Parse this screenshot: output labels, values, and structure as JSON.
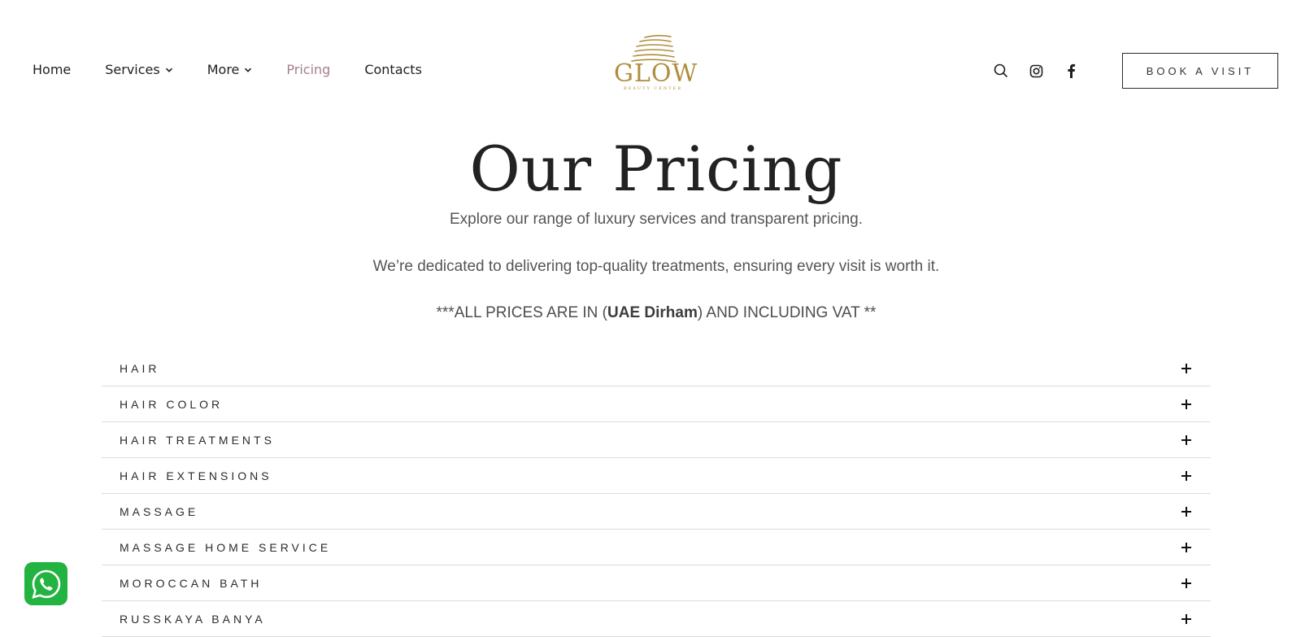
{
  "nav": {
    "items": [
      {
        "label": "Home"
      },
      {
        "label": "Services"
      },
      {
        "label": "More"
      },
      {
        "label": "Pricing"
      },
      {
        "label": "Contacts"
      }
    ]
  },
  "logo": {
    "word": "GLOW",
    "subtitle": "BEAUTY CENTER"
  },
  "header": {
    "book_label": "BOOK A VISIT"
  },
  "hero": {
    "title": "Our Pricing",
    "line1": "Explore our range of luxury services and transparent pricing.",
    "line2": "We’re dedicated to delivering top-quality treatments, ensuring every visit is worth it.",
    "line3_pre": "***ALL PRICES ARE IN (",
    "line3_bold": "UAE Dirham",
    "line3_post": ") AND  INCLUDING VAT **"
  },
  "accordion": {
    "items": [
      {
        "label": "HAIR"
      },
      {
        "label": "HAIR COLOR"
      },
      {
        "label": "HAIR TREATMENTS"
      },
      {
        "label": "HAIR EXTENSIONS"
      },
      {
        "label": "MASSAGE"
      },
      {
        "label": "MASSAGE HOME SERVICE"
      },
      {
        "label": "MOROCCAN BATH"
      },
      {
        "label": "RUSSKAYA BANYA"
      }
    ]
  },
  "colors": {
    "accent_gold": "#b08d3e",
    "active_nav": "#a57e8c",
    "whatsapp": "#22b341"
  },
  "icons": [
    "chevron-down-icon",
    "search-icon",
    "instagram-icon",
    "facebook-icon",
    "plus-icon",
    "whatsapp-icon"
  ]
}
